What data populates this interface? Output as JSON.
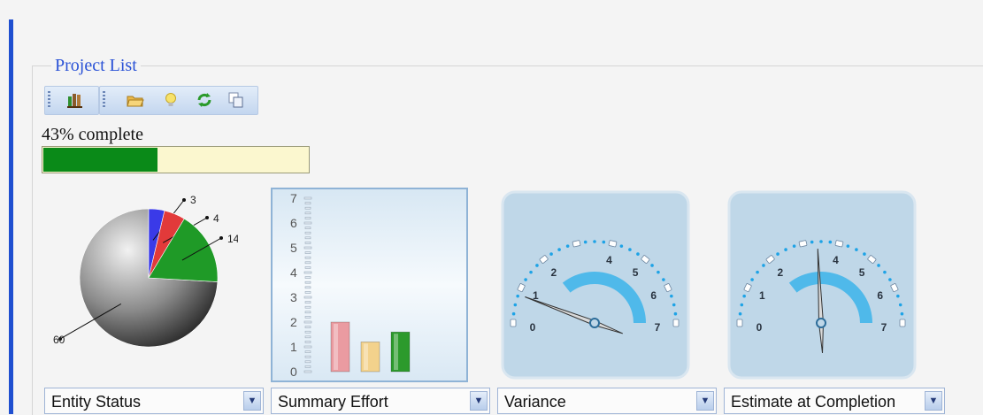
{
  "panel": {
    "title": "Project List"
  },
  "toolbar": {
    "group1": [
      {
        "icon": "books-icon"
      }
    ],
    "group2": [
      {
        "icon": "open-folder-icon"
      },
      {
        "icon": "lightbulb-icon"
      },
      {
        "icon": "refresh-icon"
      },
      {
        "icon": "copy-icon"
      }
    ]
  },
  "progress": {
    "label": "43% complete",
    "percent": 43,
    "color": "#0a8a18"
  },
  "selectors": [
    {
      "label": "Entity Status"
    },
    {
      "label": "Summary Effort"
    },
    {
      "label": "Variance"
    },
    {
      "label": "Estimate at Completion"
    }
  ],
  "chart_data": [
    {
      "type": "pie",
      "slices": [
        {
          "value": 60,
          "label": "60",
          "color": "#555555"
        },
        {
          "value": 3,
          "label": "3",
          "color": "#3a3ae8"
        },
        {
          "value": 4,
          "label": "4",
          "color": "#e23a3a"
        },
        {
          "value": 14,
          "label": "14",
          "color": "#1f9a27"
        }
      ]
    },
    {
      "type": "bar",
      "values": [
        2,
        1.2,
        1.6
      ],
      "colors": [
        "#ea9ba1",
        "#f3d28c",
        "#2c9a2c"
      ],
      "ylim": [
        0,
        7
      ],
      "yticks": [
        "0",
        "1",
        "2",
        "3",
        "4",
        "5",
        "6",
        "7"
      ]
    },
    {
      "type": "gauge",
      "range": [
        0,
        7
      ],
      "ticks": [
        "0",
        "1",
        "2",
        "4",
        "5",
        "6",
        "7"
      ],
      "needle": 0.8
    },
    {
      "type": "gauge",
      "range": [
        0,
        7
      ],
      "ticks": [
        "0",
        "1",
        "2",
        "4",
        "5",
        "6",
        "7"
      ],
      "needle": 3.4
    }
  ]
}
